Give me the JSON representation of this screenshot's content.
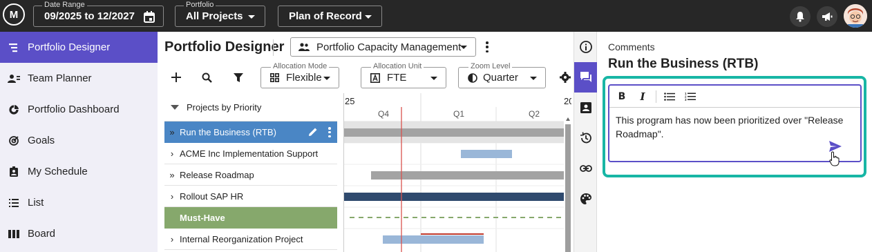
{
  "topbar": {
    "date_range": {
      "label": "Date Range",
      "value": "09/2025 to 12/2027"
    },
    "portfolio": {
      "label": "Portfolio",
      "value": "All Projects"
    },
    "plan": {
      "value": "Plan of Record"
    }
  },
  "sidebar": {
    "items": [
      {
        "label": "Portfolio Designer",
        "icon": "designer-icon",
        "active": true
      },
      {
        "label": "Team Planner",
        "icon": "team-icon"
      },
      {
        "label": "Portfolio Dashboard",
        "icon": "dashboard-icon"
      },
      {
        "label": "Goals",
        "icon": "goals-icon"
      },
      {
        "label": "My Schedule",
        "icon": "schedule-icon"
      },
      {
        "label": "List",
        "icon": "list-icon"
      },
      {
        "label": "Board",
        "icon": "board-icon"
      }
    ]
  },
  "main": {
    "title": "Portfolio Designer",
    "view_selector": "Portfolio Capacity Management",
    "allocation_mode": {
      "label": "Allocation Mode",
      "value": "Flexible"
    },
    "allocation_unit": {
      "label": "Allocation Unit",
      "value": "FTE"
    },
    "zoom_level": {
      "label": "Zoom Level",
      "value": "Quarter"
    },
    "tree_header": "Projects by Priority",
    "rows": [
      {
        "label": "Run the Business (RTB)",
        "kind": "selected"
      },
      {
        "label": "ACME Inc Implementation Support",
        "kind": "normal"
      },
      {
        "label": "Release Roadmap",
        "kind": "program"
      },
      {
        "label": "Rollout SAP HR",
        "kind": "normal"
      },
      {
        "label": "Must-Have",
        "kind": "group"
      },
      {
        "label": "Internal Reorganization Project",
        "kind": "normal"
      }
    ],
    "gantt": {
      "year_left": "25",
      "year_right": "20",
      "quarters": [
        "Q4",
        "Q1",
        "Q2"
      ]
    }
  },
  "comments": {
    "label": "Comments",
    "title": "Run the Business (RTB)",
    "text": "This program has now been prioritized over \"Release Roadmap\"."
  },
  "colors": {
    "accent": "#5b4fc7",
    "highlight": "#18b6a5",
    "selected_row": "#4a86c5",
    "group_row": "#86a86c"
  }
}
